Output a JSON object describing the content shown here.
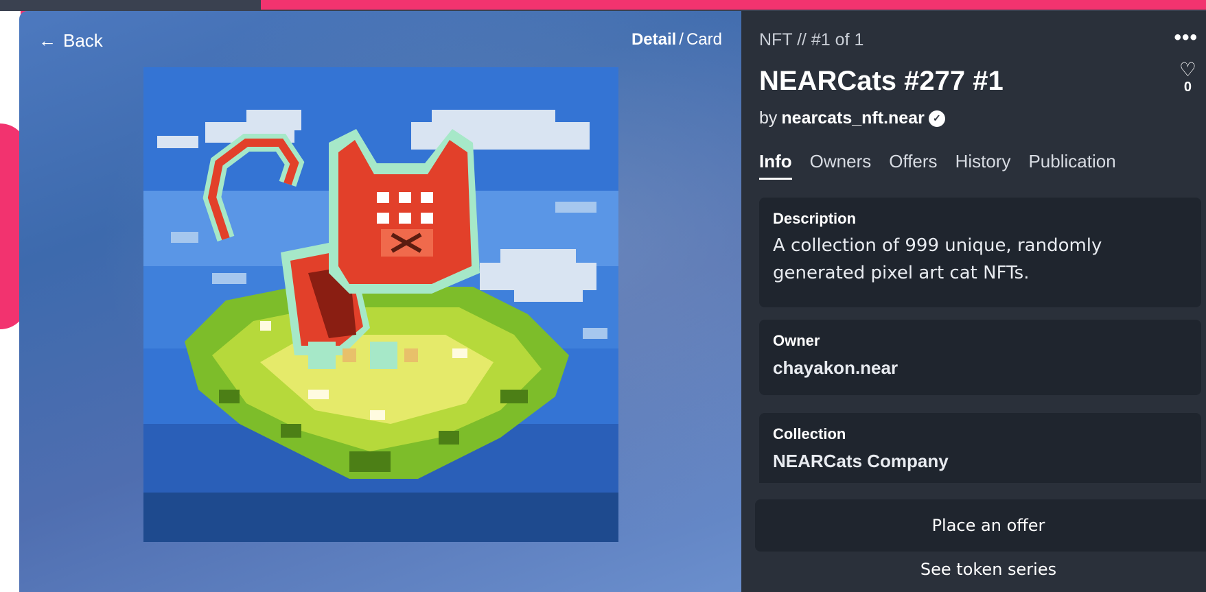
{
  "detail": {
    "back_label": "Back",
    "view_mode": {
      "active": "Detail",
      "separator": "/",
      "other": "Card"
    },
    "image": {
      "alt_subject": "NEARCats #277 pixel art"
    },
    "edition": "NFT // #1 of 1",
    "title": "NEARCats #277 #1",
    "by_prefix": "by",
    "creator": "nearcats_nft.near",
    "likes": "0",
    "tabs": [
      "Info",
      "Owners",
      "Offers",
      "History",
      "Publication"
    ],
    "active_tab": "Info",
    "info": {
      "description_label": "Description",
      "description": "A collection of 999 unique, randomly generated pixel art cat NFTs.",
      "owner_label": "Owner",
      "owner": "chayakon.near",
      "collection_label": "Collection",
      "collection": "NEARCats Company"
    },
    "offer_button": "Place an offer",
    "series_link": "See token series"
  },
  "icons": {
    "back": "arrow-left-icon",
    "menu": "more-dots-icon",
    "like": "heart-icon",
    "verified": "verified-badge-icon"
  },
  "colors": {
    "panel_bg": "#2a303a",
    "card_bg": "#1f252e",
    "accent_pink": "#f2336f",
    "image_sky": "#3474d4"
  }
}
